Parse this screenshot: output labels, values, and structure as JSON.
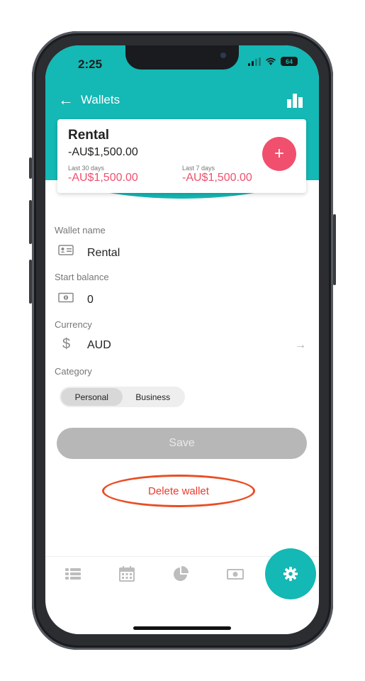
{
  "status_bar": {
    "time": "2:25",
    "battery": "64"
  },
  "header": {
    "title": "Wallets"
  },
  "wallet_card": {
    "name": "Rental",
    "balance": "-AU$1,500.00",
    "last30_label": "Last 30 days",
    "last30_value": "-AU$1,500.00",
    "last7_label": "Last 7 days",
    "last7_value": "-AU$1,500.00",
    "add_label": "+"
  },
  "form": {
    "wallet_name_label": "Wallet name",
    "wallet_name_value": "Rental",
    "start_balance_label": "Start balance",
    "start_balance_value": "0",
    "currency_label": "Currency",
    "currency_symbol": "$",
    "currency_value": "AUD",
    "category_label": "Category",
    "category_options": [
      "Personal",
      "Business"
    ],
    "category_selected": "Personal"
  },
  "actions": {
    "save_label": "Save",
    "delete_label": "Delete wallet"
  },
  "tabbar": {
    "icons": [
      "list-icon",
      "calendar-icon",
      "pie-chart-icon",
      "cash-icon",
      "gear-icon"
    ],
    "active": "gear-icon"
  },
  "colors": {
    "accent": "#14b8b4",
    "negative": "#f0506e",
    "annotation": "#ea4d24",
    "delete_text": "#e83b2e"
  }
}
